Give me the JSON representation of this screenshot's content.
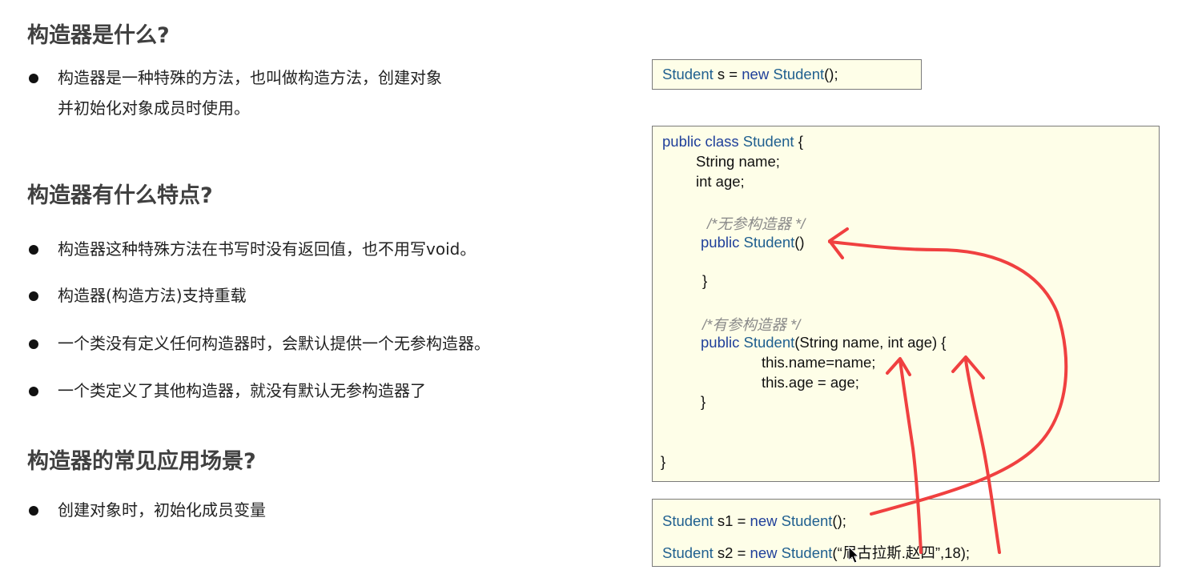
{
  "sections": [
    {
      "heading": "构造器是什么?",
      "bullets": [
        [
          "构造器是一种特殊的方法，也叫做构造方法，创建对象",
          "并初始化对象成员时使用。"
        ]
      ]
    },
    {
      "heading": "构造器有什么特点?",
      "bullets": [
        [
          "构造器这种特殊方法在书写时没有返回值，也不用写void。"
        ],
        [
          "构造器(构造方法)支持重载"
        ],
        [
          "一个类没有定义任何构造器时，会默认提供一个无参构造器。"
        ],
        [
          "一个类定义了其他构造器，就没有默认无参构造器了"
        ]
      ]
    },
    {
      "heading": "构造器的常见应用场景?",
      "bullets": [
        [
          "创建对象时，初始化成员变量"
        ]
      ]
    }
  ],
  "code": {
    "box1": {
      "t1": "Student",
      "t2": " s = ",
      "t3": "new",
      "t4": " ",
      "t5": "Student",
      "t6": "();"
    },
    "box2": {
      "l1a": "public class",
      "l1b": " ",
      "l1c": "Student",
      "l1d": " {",
      "l2": "String name;",
      "l3": "int age;",
      "c1": "/*无参构造器 */",
      "l4a": "public",
      "l4b": " ",
      "l4c": "Student",
      "l4d": "()",
      "l5": "}",
      "c2": "/*有参构造器 */",
      "l6a": "public",
      "l6b": " ",
      "l6c": "Student",
      "l6d": "(String name,  int age) {",
      "l7": "this.name=name;",
      "l8": "this.age = age;",
      "l9": "}",
      "l10": "}"
    },
    "box3": {
      "r1a": "Student",
      "r1b": " s1 = ",
      "r1c": "new",
      "r1d": " ",
      "r1e": "Student",
      "r1f": "();",
      "r2a": "Student",
      "r2b": " s2 = ",
      "r2c": "new",
      "r2d": " ",
      "r2e": "Student",
      "r2f": "(“尼古拉斯.赵四”,18);"
    }
  },
  "annotation": {
    "stroke_color": "#f04040",
    "cursor_color": "#000000"
  }
}
